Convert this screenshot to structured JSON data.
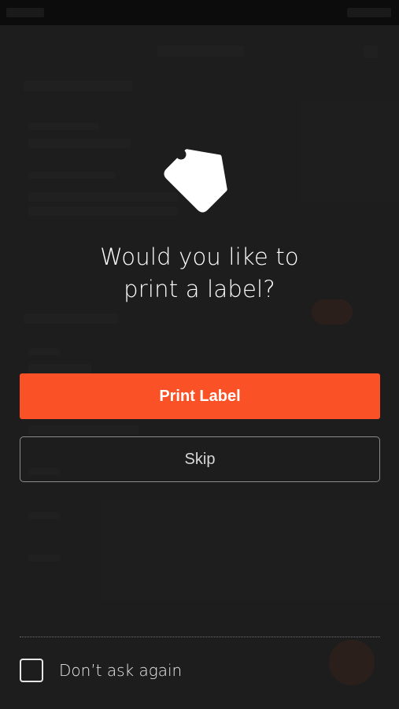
{
  "dialog": {
    "icon": "tag-icon",
    "title_line1": "Would you like to",
    "title_line2": "print a label?",
    "primary_button": "Print Label",
    "secondary_button": "Skip",
    "checkbox_label": "Don’t ask again",
    "checkbox_checked": false
  },
  "colors": {
    "accent": "#fb5126",
    "background": "#1e1e1e",
    "text": "#ffffff",
    "border": "#8c8c8c"
  }
}
